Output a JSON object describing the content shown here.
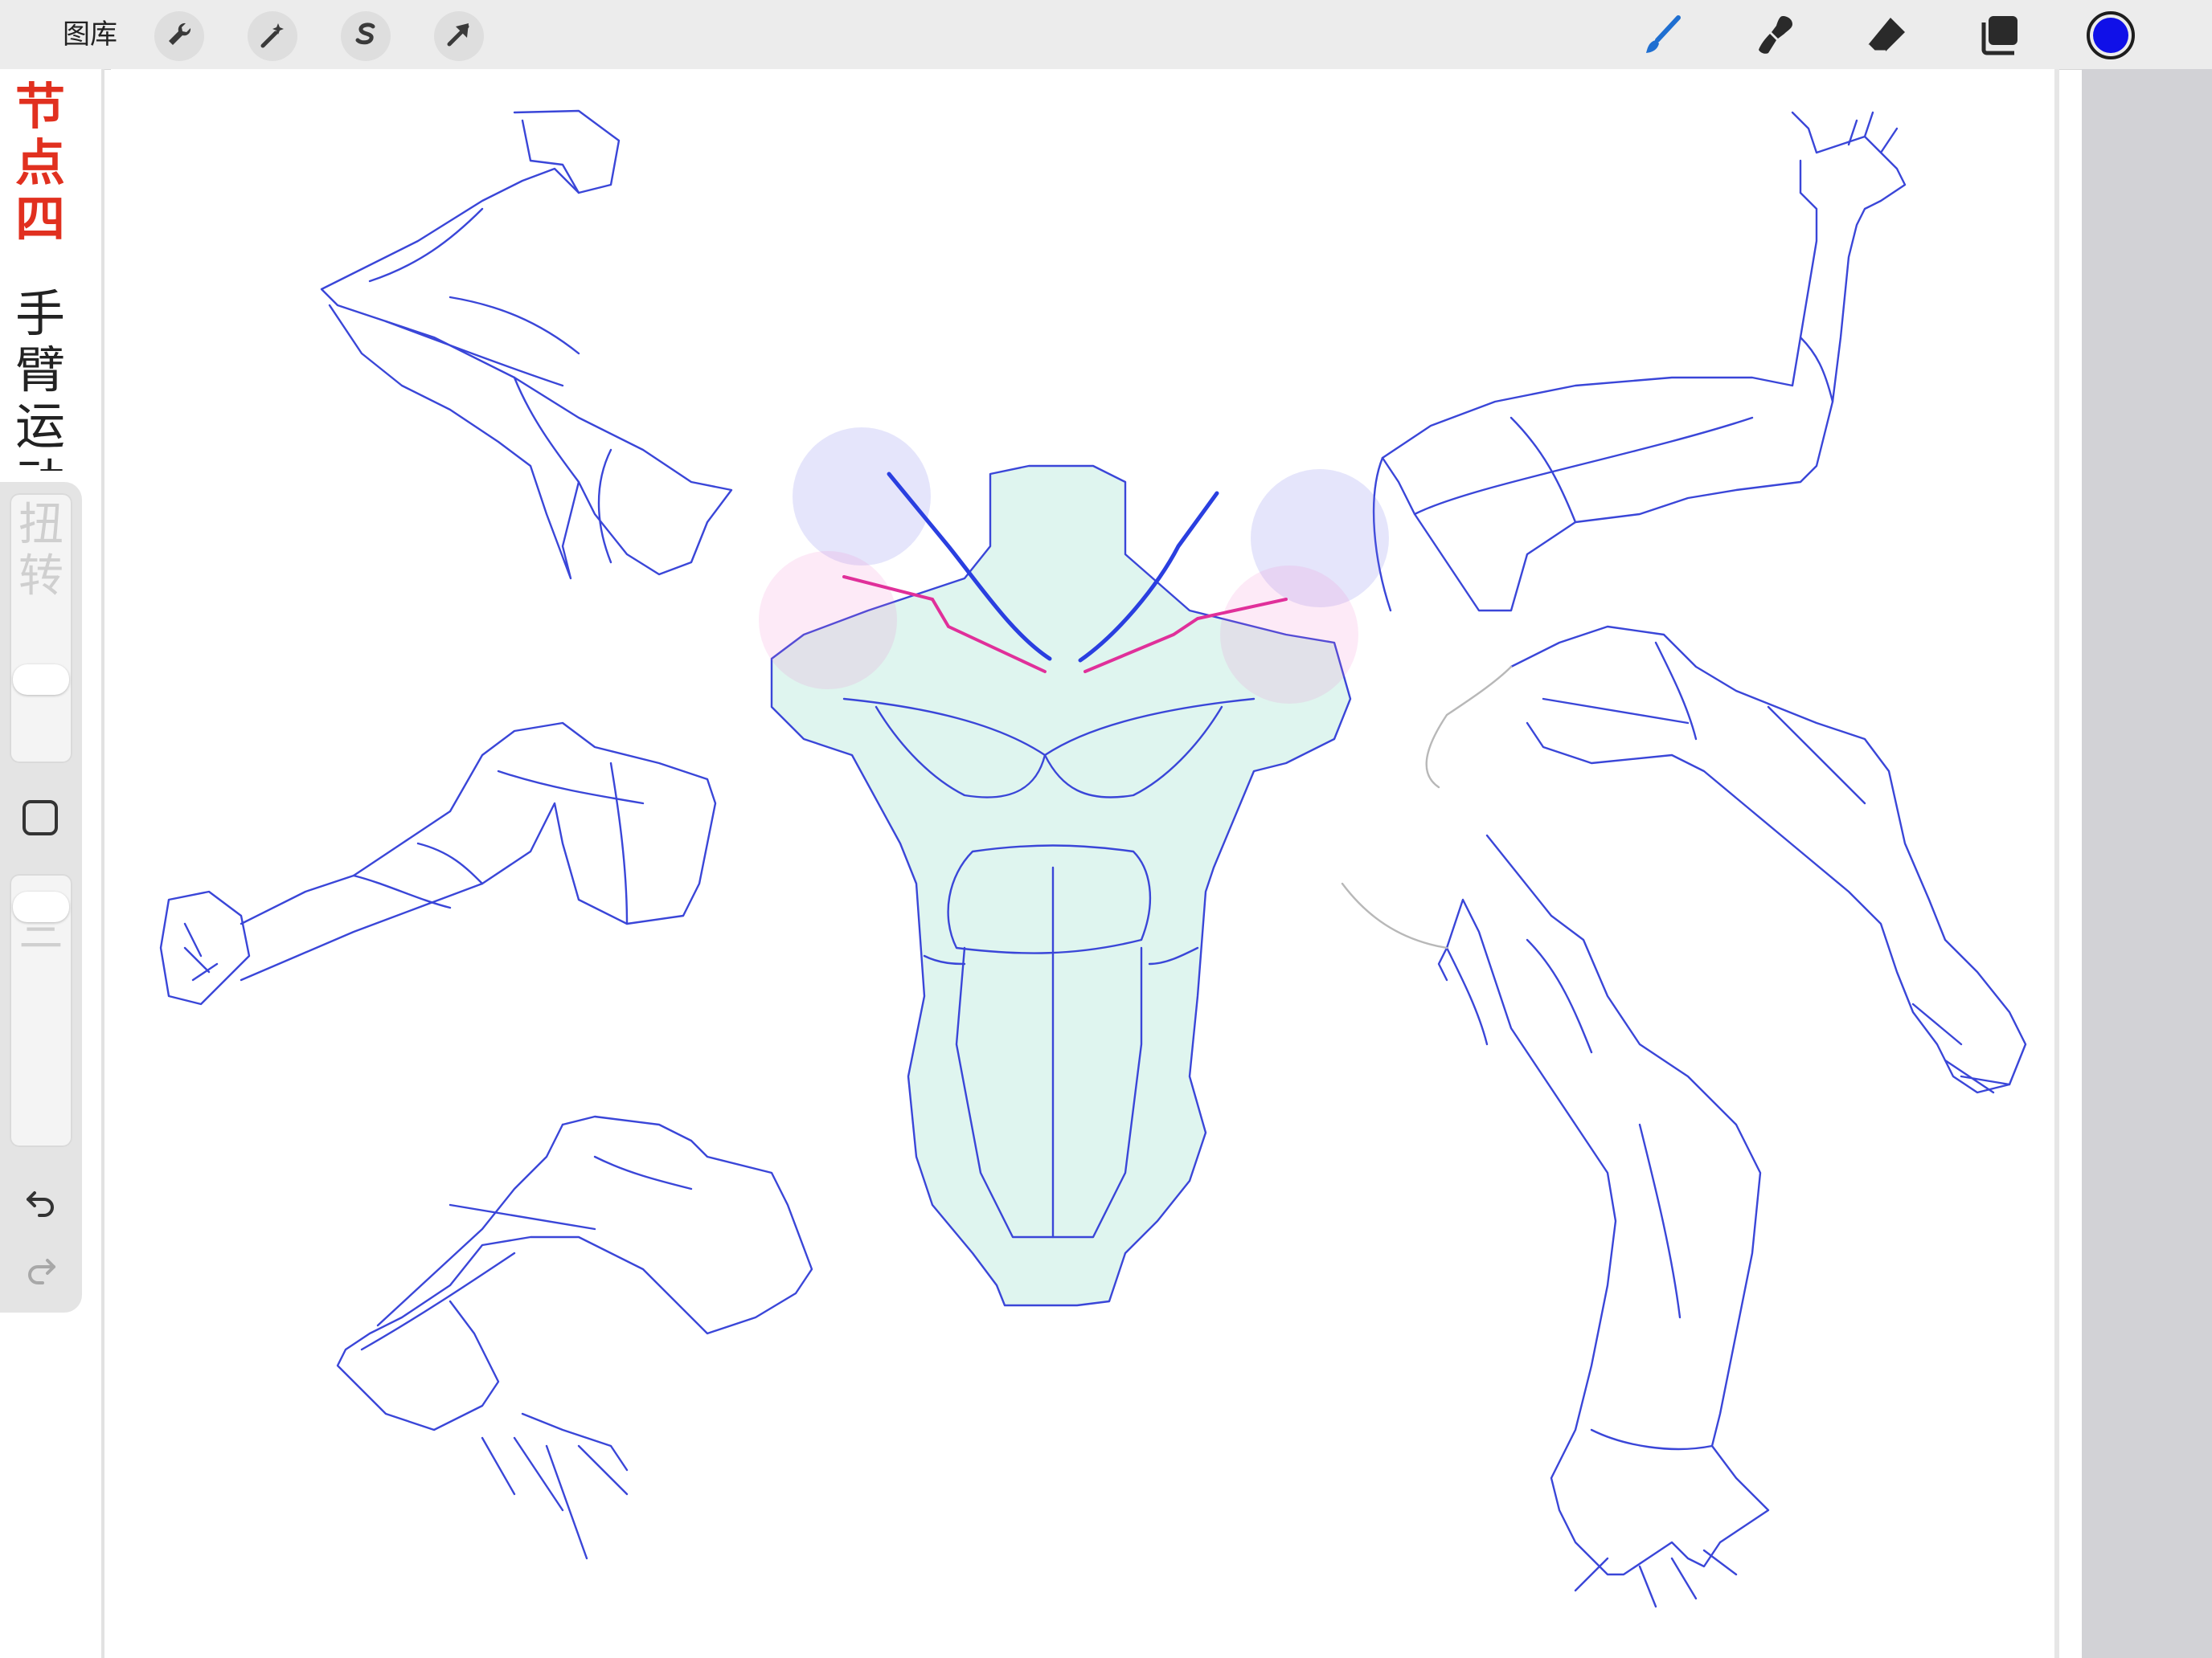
{
  "toolbar": {
    "gallery_label": "图库",
    "left_tools": [
      {
        "icon": "wrench-icon",
        "name": "actions"
      },
      {
        "icon": "magic-wand-icon",
        "name": "adjustments"
      },
      {
        "icon": "selection-s-icon",
        "name": "selection"
      },
      {
        "icon": "arrow-cursor-icon",
        "name": "transform"
      }
    ],
    "right_tools": [
      {
        "icon": "brush-icon",
        "name": "paint",
        "active": true
      },
      {
        "icon": "smudge-icon",
        "name": "smudge"
      },
      {
        "icon": "eraser-icon",
        "name": "eraser"
      },
      {
        "icon": "layers-icon",
        "name": "layers"
      }
    ],
    "current_color": "#1010e8"
  },
  "canvas_text": {
    "title_red": "节点四",
    "title_black": "手臂运动"
  },
  "sidebar": {
    "brush_size_ghost": "扭转",
    "opacity_ghost": "三",
    "brush_size_level": 0.28,
    "opacity_level": 0.06,
    "modifier_icon": "square-icon",
    "undo_icon": "undo-icon",
    "redo_icon": "redo-icon"
  },
  "colors": {
    "accent_blue": "#1010e8",
    "sketch_line": "#3a46d8",
    "torso_fill": "#d6f2ea",
    "clavicle_pink": "#e0309a",
    "title_red": "#e1301f"
  }
}
